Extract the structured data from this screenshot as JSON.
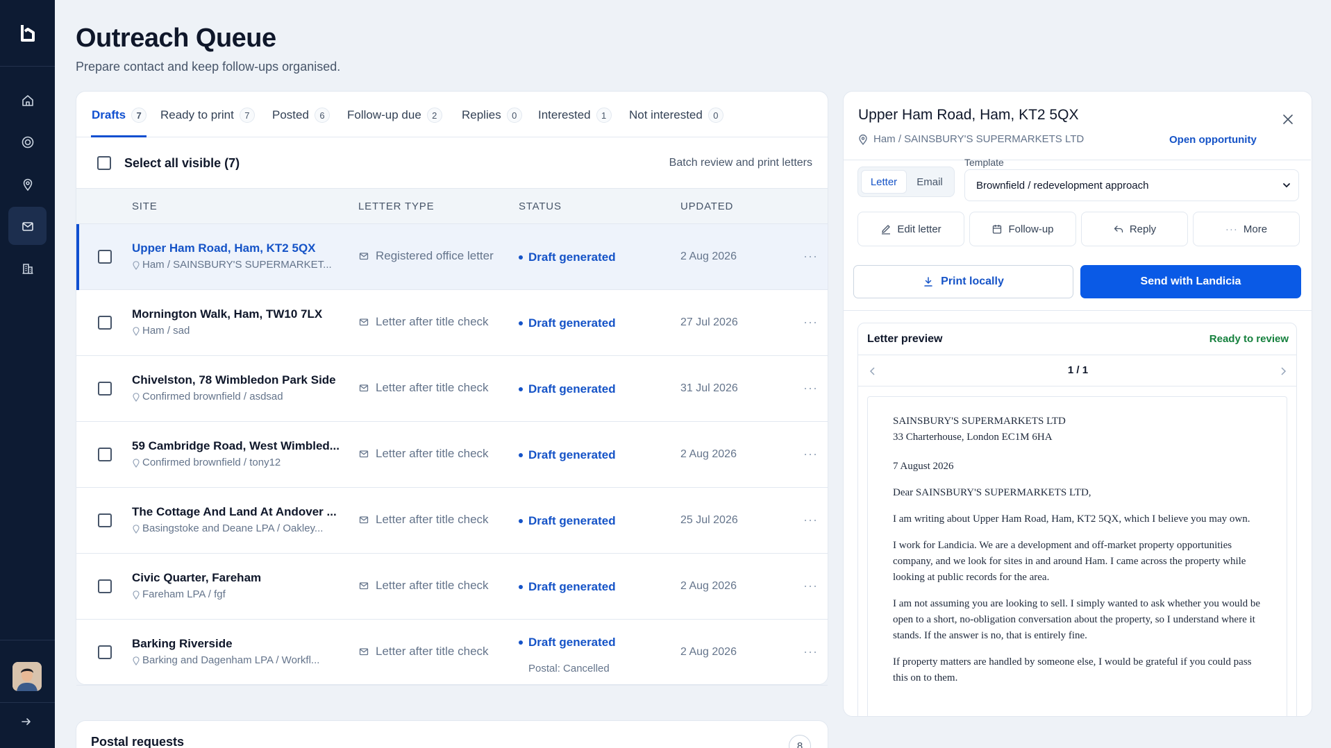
{
  "page": {
    "title": "Outreach Queue",
    "subtitle": "Prepare contact and keep follow-ups organised."
  },
  "sidebar": {
    "items": [
      "home",
      "target",
      "map-pin",
      "mail",
      "building"
    ],
    "active": "mail"
  },
  "tabs": [
    {
      "label": "Drafts",
      "count": "7",
      "active": true
    },
    {
      "label": "Ready to print",
      "count": "7"
    },
    {
      "label": "Posted",
      "count": "6"
    },
    {
      "label": "Follow-up due",
      "count": "2"
    },
    {
      "label": "Replies",
      "count": "0"
    },
    {
      "label": "Interested",
      "count": "1"
    },
    {
      "label": "Not interested",
      "count": "0"
    }
  ],
  "select_all": {
    "label": "Select all visible (7)",
    "batch_label": "Batch review and print letters"
  },
  "columns": {
    "site": "SITE",
    "letter_type": "LETTER TYPE",
    "status": "STATUS",
    "updated": "UPDATED"
  },
  "rows": [
    {
      "site": "Upper Ham Road, Ham, KT2 5QX",
      "sub": "Ham / SAINSBURY'S SUPERMARKET...",
      "type": "Registered office letter",
      "status": "Draft generated",
      "status2": "",
      "updated": "2 Aug 2026",
      "selected": true
    },
    {
      "site": "Mornington Walk, Ham, TW10 7LX",
      "sub": "Ham / sad",
      "type": "Letter after title check",
      "status": "Draft generated",
      "status2": "",
      "updated": "27 Jul 2026"
    },
    {
      "site": "Chivelston, 78 Wimbledon Park Side",
      "sub": "Confirmed brownfield / asdsad",
      "type": "Letter after title check",
      "status": "Draft generated",
      "status2": "",
      "updated": "31 Jul 2026"
    },
    {
      "site": "59 Cambridge Road, West Wimbled...",
      "sub": "Confirmed brownfield / tony12",
      "type": "Letter after title check",
      "status": "Draft generated",
      "status2": "",
      "updated": "2 Aug 2026"
    },
    {
      "site": "The Cottage And Land At Andover ...",
      "sub": "Basingstoke and Deane LPA / Oakley...",
      "type": "Letter after title check",
      "status": "Draft generated",
      "status2": "",
      "updated": "25 Jul 2026"
    },
    {
      "site": "Civic Quarter, Fareham",
      "sub": "Fareham LPA / fgf",
      "type": "Letter after title check",
      "status": "Draft generated",
      "status2": "",
      "updated": "2 Aug 2026"
    },
    {
      "site": "Barking Riverside",
      "sub": "Barking and Dagenham LPA / Workfl...",
      "type": "Letter after title check",
      "status": "Draft generated",
      "status2": "Postal: Cancelled",
      "updated": "2 Aug 2026"
    }
  ],
  "panel": {
    "title": "Upper Ham Road, Ham, KT2 5QX",
    "sub": "Ham / SAINSBURY'S SUPERMARKETS LTD",
    "open_link": "Open opportunity",
    "channel": {
      "letter": "Letter",
      "email": "Email",
      "active": "Letter"
    },
    "template_label": "Template",
    "template_value": "Brownfield / redevelopment approach",
    "actions": {
      "edit": "Edit letter",
      "followup": "Follow-up",
      "reply": "Reply",
      "more": "More"
    },
    "print": "Print locally",
    "send": "Send with Landicia",
    "preview": {
      "title": "Letter preview",
      "status": "Ready to review",
      "page": "1 / 1",
      "addr1": "SAINSBURY'S SUPERMARKETS LTD",
      "addr2": "33 Charterhouse, London EC1M 6HA",
      "date": "7 August 2026",
      "greeting": "Dear SAINSBURY'S SUPERMARKETS LTD,",
      "p1": "I am writing about Upper Ham Road, Ham, KT2 5QX, which I believe you may own.",
      "p2": "I work for Landicia. We are a development and off-market property opportunities company, and we look for sites in and around Ham. I came across the property while looking at public records for the area.",
      "p3": "I am not assuming you are looking to sell. I simply wanted to ask whether you would be open to a short, no-obligation conversation about the property, so I understand where it stands. If the answer is no, that is entirely fine.",
      "p4": "If property matters are handled by someone else, I would be grateful if you could pass this on to them."
    }
  },
  "postal": {
    "title": "Postal requests",
    "count": "8"
  }
}
